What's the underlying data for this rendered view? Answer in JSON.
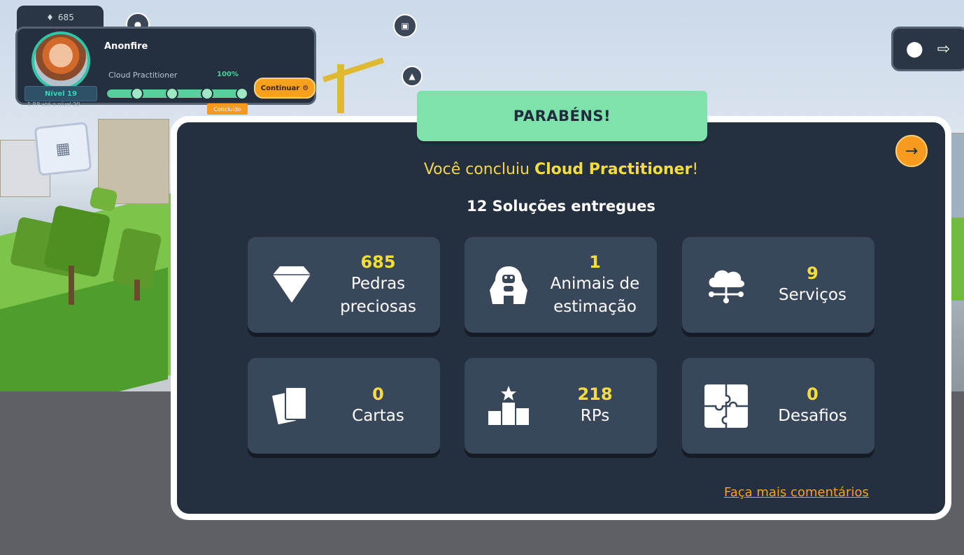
{
  "hud": {
    "top_gems": "685",
    "player_name": "Anonfire",
    "course_name": "Cloud Practitioner",
    "course_percent": "100%",
    "course_progress": 1.0,
    "level": "Nível 19",
    "level_sub": "1 RP até o nível 20",
    "continue_label": "Continuar",
    "badge": "Concluído"
  },
  "modal": {
    "ribbon": "PARABÉNS!",
    "congrats_prefix": "Você concluiu ",
    "congrats_course": "Cloud Practitioner",
    "congrats_suffix": "!",
    "delivered": "12 Soluções entregues",
    "feedback_link": "Faça mais comentários",
    "stats": [
      {
        "value": "685",
        "label1": "Pedras",
        "label2": "preciosas",
        "icon": "diamond-icon"
      },
      {
        "value": "1",
        "label1": "Animais de",
        "label2": "estimação",
        "icon": "gorilla-icon"
      },
      {
        "value": "9",
        "label1": "Serviços",
        "label2": "",
        "icon": "cloud-network-icon"
      },
      {
        "value": "0",
        "label1": "Cartas",
        "label2": "",
        "icon": "cards-icon"
      },
      {
        "value": "218",
        "label1": "RPs",
        "label2": "",
        "icon": "podium-icon"
      },
      {
        "value": "0",
        "label1": "Desafios",
        "label2": "",
        "icon": "puzzle-icon"
      }
    ]
  },
  "colors": {
    "modal_bg": "#243040",
    "card_bg": "#39475a",
    "ribbon": "#7de3ab",
    "accent_yellow": "#f7dd3c",
    "accent_orange": "#f89a1c"
  }
}
